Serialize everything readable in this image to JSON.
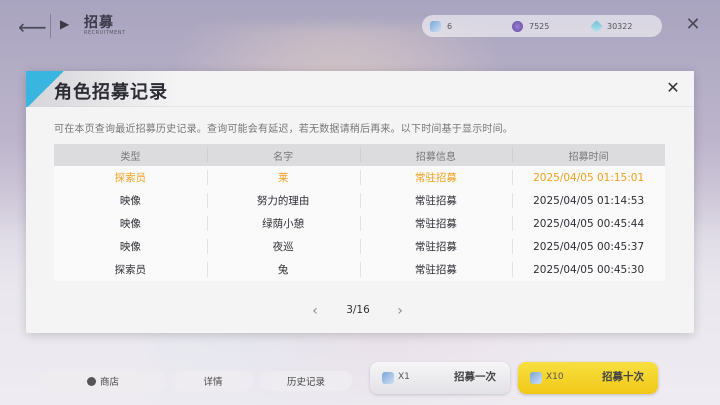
{
  "header": {
    "title": "招募",
    "subtitle": "RECRUITMENT"
  },
  "currencies": [
    {
      "icon": "pass-ticket-icon",
      "value": "6"
    },
    {
      "icon": "crystal-orb-icon",
      "value": "7525"
    },
    {
      "icon": "diamond-icon",
      "value": "30322"
    }
  ],
  "dialog": {
    "title": "角色招募记录",
    "description": "可在本页查询最近招募历史记录。查询可能会有延迟，若无数据请稍后再来。以下时间基于显示时间。",
    "columns": [
      "类型",
      "名字",
      "招募信息",
      "招募时间"
    ],
    "rows": [
      {
        "type": "探索员",
        "name": "莱",
        "info": "常驻招募",
        "time": "2025/04/05 01:15:01",
        "highlight": true
      },
      {
        "type": "映像",
        "name": "努力的理由",
        "info": "常驻招募",
        "time": "2025/04/05 01:14:53",
        "highlight": false
      },
      {
        "type": "映像",
        "name": "绿荫小憩",
        "info": "常驻招募",
        "time": "2025/04/05 00:45:44",
        "highlight": false
      },
      {
        "type": "映像",
        "name": "夜巡",
        "info": "常驻招募",
        "time": "2025/04/05 00:45:37",
        "highlight": false
      },
      {
        "type": "探索员",
        "name": "兔",
        "info": "常驻招募",
        "time": "2025/04/05 00:45:30",
        "highlight": false
      }
    ],
    "pager": "3/16"
  },
  "bottom": {
    "shop_label": "商店",
    "detail_label": "详情",
    "history_label": "历史记录",
    "pull1": {
      "count": "X1",
      "label": "招募一次"
    },
    "pull10": {
      "count": "X10",
      "label": "招募十次"
    }
  },
  "colors": {
    "highlight": "#f0a020",
    "accent": "#38b6e0",
    "pull10_bg": "#f1c817"
  }
}
